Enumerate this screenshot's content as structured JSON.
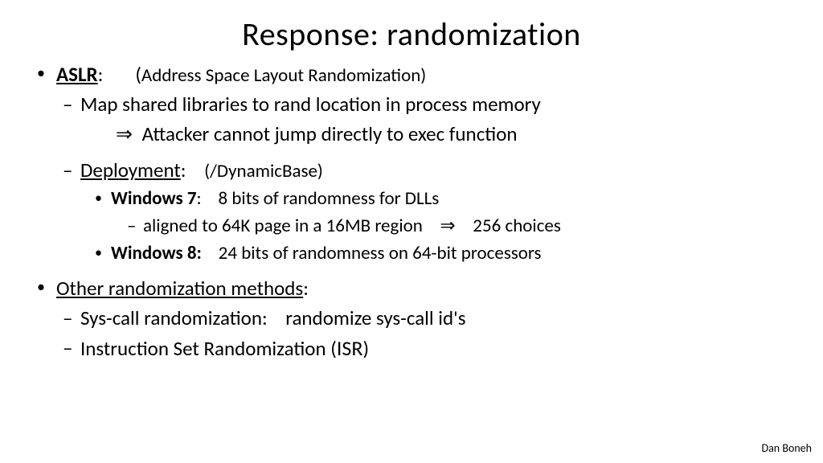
{
  "title": "Response:   randomization",
  "aslr": {
    "label_bold": "ASLR",
    "label_colon": ":",
    "paren_open": "(",
    "expansion": "Address Space Layout Randomization)"
  },
  "shared_libs": "Map shared libraries to rand location in process memory",
  "arrow": "⇒",
  "attacker_line": "   Attacker cannot jump directly to exec function",
  "deployment": {
    "label": "Deployment",
    "colon": ":",
    "flag": "(/DynamicBase)"
  },
  "win7": {
    "label": "Windows 7",
    "colon": ":",
    "text": "    8 bits of randomness for DLLs"
  },
  "win7_sub_a": "aligned to 64K page in a 16MB region   ",
  "win7_sub_b": "   256 choices",
  "win8": {
    "label": "Windows 8:",
    "text": "    24 bits of randomness on 64-bit processors"
  },
  "other_methods": {
    "label": "Other randomization methods",
    "colon": ":"
  },
  "syscall": "Sys-call randomization:    randomize sys-call id's",
  "isr_pre": "Instruction Set Randomization (",
  "isr": "ISR",
  "isr_post": ")",
  "footer": "Dan Boneh"
}
